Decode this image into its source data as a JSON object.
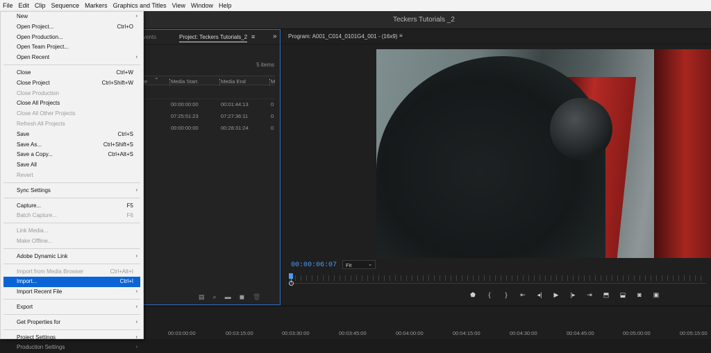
{
  "menubar": [
    "File",
    "Edit",
    "Clip",
    "Sequence",
    "Markers",
    "Graphics and Titles",
    "View",
    "Window",
    "Help"
  ],
  "app_title": "Teckers Tutorials _2",
  "project_panel": {
    "tab_events": "vents",
    "tab_project": "Project: Teckers Tutorials_2",
    "items_count": "5 items",
    "columns": [
      "te",
      "Media Start",
      "Media End",
      "M"
    ],
    "rows": [
      {
        "start": "00:00:00:00",
        "end": "00:01:44:13",
        "m": "0"
      },
      {
        "start": "07:25:51:23",
        "end": "07:27:36:11",
        "m": "0"
      },
      {
        "start": "00:00:00:00",
        "end": "00:28:31:24",
        "m": "0"
      }
    ]
  },
  "program": {
    "title": "Program: A001_C014_0101G4_001 - (16x9)",
    "timecode": "00:00:06:07",
    "zoom": "Fit"
  },
  "timeline_times": [
    "00:03:00:00",
    "00:03:15:00",
    "00:03:30:00",
    "00:03:45:00",
    "00:04:00:00",
    "00:04:15:00",
    "00:04:30:00",
    "00:04:45:00",
    "00:05:00:00",
    "00:05:15:00"
  ],
  "file_menu": [
    {
      "label": "New",
      "arrow": true
    },
    {
      "label": "Open Project...",
      "shortcut": "Ctrl+O"
    },
    {
      "label": "Open Production..."
    },
    {
      "label": "Open Team Project..."
    },
    {
      "label": "Open Recent",
      "arrow": true
    },
    {
      "sep": true
    },
    {
      "label": "Close",
      "shortcut": "Ctrl+W"
    },
    {
      "label": "Close Project",
      "shortcut": "Ctrl+Shift+W"
    },
    {
      "label": "Close Production",
      "disabled": true
    },
    {
      "label": "Close All Projects"
    },
    {
      "label": "Close All Other Projects",
      "disabled": true
    },
    {
      "label": "Refresh All Projects",
      "disabled": true
    },
    {
      "label": "Save",
      "shortcut": "Ctrl+S"
    },
    {
      "label": "Save As...",
      "shortcut": "Ctrl+Shift+S"
    },
    {
      "label": "Save a Copy...",
      "shortcut": "Ctrl+Alt+S"
    },
    {
      "label": "Save All"
    },
    {
      "label": "Revert",
      "disabled": true
    },
    {
      "sep": true
    },
    {
      "label": "Sync Settings",
      "arrow": true
    },
    {
      "sep": true
    },
    {
      "label": "Capture...",
      "shortcut": "F5"
    },
    {
      "label": "Batch Capture...",
      "shortcut": "F6",
      "disabled": true
    },
    {
      "sep": true
    },
    {
      "label": "Link Media...",
      "disabled": true
    },
    {
      "label": "Make Offline...",
      "disabled": true
    },
    {
      "sep": true
    },
    {
      "label": "Adobe Dynamic Link",
      "arrow": true
    },
    {
      "sep": true
    },
    {
      "label": "Import from Media Browser",
      "shortcut": "Ctrl+Alt+I",
      "disabled": true
    },
    {
      "label": "Import...",
      "shortcut": "Ctrl+I",
      "highlight": true
    },
    {
      "label": "Import Recent File",
      "arrow": true
    },
    {
      "sep": true
    },
    {
      "label": "Export",
      "arrow": true
    },
    {
      "sep": true
    },
    {
      "label": "Get Properties for",
      "arrow": true
    },
    {
      "sep": true
    },
    {
      "label": "Project Settings",
      "arrow": true
    },
    {
      "label": "Production Settings",
      "arrow": true,
      "disabled": true
    }
  ],
  "colors": {
    "accent": "#0a64d6",
    "timecode": "#4d9bf5"
  }
}
